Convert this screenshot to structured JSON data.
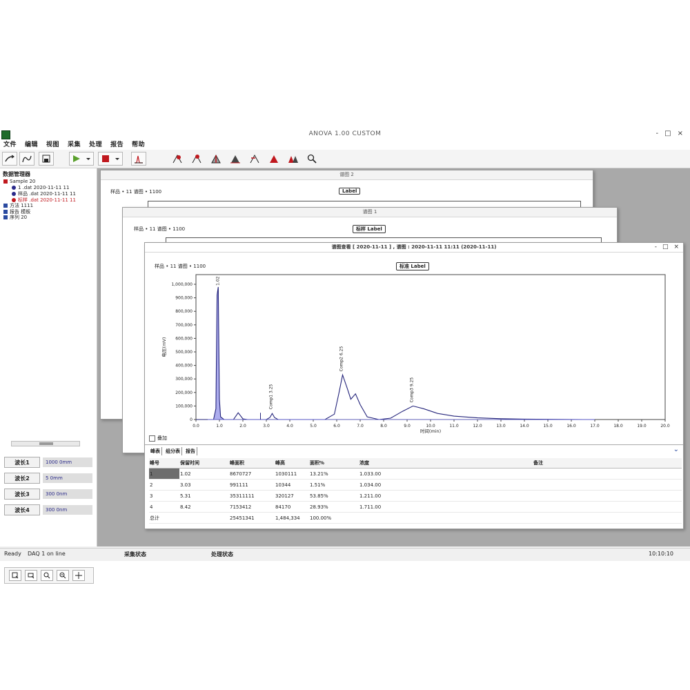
{
  "app": {
    "title": "ANOVA 1.00 CUSTOM",
    "window_controls": [
      "-",
      "□",
      "×"
    ]
  },
  "menu": [
    "文件",
    "编辑",
    "视图",
    "采集",
    "处理",
    "报告",
    "帮助"
  ],
  "toolbar": {
    "buttons": [
      "open-icon",
      "curve-icon",
      "save-icon",
      "run-icon",
      "stop-icon",
      "integrate-icon",
      "peak-icon-1",
      "peak-icon-2",
      "peak-icon-3",
      "peak-icon-4",
      "peak-icon-5",
      "peak-icon-6",
      "peak-icon-7",
      "search-icon"
    ],
    "colors": {
      "run": "#5aa02c",
      "stop": "#c0181e",
      "peak": "#c0181e"
    }
  },
  "tree": {
    "header": "数据管理器",
    "items": [
      {
        "label": "Sample 20",
        "color": "#c0181e",
        "kind": "sq",
        "indent": 0
      },
      {
        "label": "1 .dat 2020-11-11 11",
        "color": "#2a2a8a",
        "kind": "dot",
        "indent": 1
      },
      {
        "label": "样品 .dat 2020-11-11 11",
        "color": "#2a2a8a",
        "kind": "dot",
        "indent": 1
      },
      {
        "label": "标样 .dat 2020-11-11 11",
        "color": "#c0181e",
        "kind": "dot",
        "indent": 1,
        "text_color": "#c0181e"
      },
      {
        "label": "方法 1111",
        "color": "#2a4aa0",
        "kind": "sq",
        "indent": 0
      },
      {
        "label": "报告 模板",
        "color": "#2a4aa0",
        "kind": "sq",
        "indent": 0
      },
      {
        "label": "序列 20",
        "color": "#2a4aa0",
        "kind": "sq",
        "indent": 0
      }
    ]
  },
  "params": [
    {
      "label": "波长1",
      "value": "1000 0mm"
    },
    {
      "label": "波长2",
      "value": "5 0mm"
    },
    {
      "label": "波长3",
      "value": "300 0nm"
    },
    {
      "label": "波长4",
      "value": "300 0nm"
    }
  ],
  "zoom_tools": [
    "zoom-box-icon",
    "zoom-x-icon",
    "zoom-in-icon",
    "zoom-out-icon",
    "pan-icon"
  ],
  "back_windows": [
    {
      "title": "谱图 2",
      "header": "样品 • 11 谱图 • 1100",
      "tag": "Label"
    },
    {
      "title": "谱图 1",
      "header": "样品 • 11 谱图 • 1100",
      "tag": "标样 Label"
    }
  ],
  "front_window": {
    "title": "谱图查看 [ 2020-11-11 ] , 谱图 : 2020-11-11 11:11 (2020-11-11)",
    "header": "样品 • 11 谱图 • 1100",
    "tag": "标准 Label",
    "check_label": "叠加",
    "tabs": [
      "峰表",
      "组分表",
      "报告"
    ],
    "table": {
      "columns": [
        "峰号",
        "保留时间",
        "峰面积",
        "峰高",
        "面积%",
        "浓度",
        "备注"
      ],
      "rows": [
        [
          "1",
          "1.02",
          "8670727",
          "1030111",
          "13.21%",
          "1.033.00",
          ""
        ],
        [
          "2",
          "3.03",
          "991111",
          "10344",
          "1.51%",
          "1.034.00",
          ""
        ],
        [
          "3",
          "5.31",
          "35311111",
          "320127",
          "53.85%",
          "1.211.00",
          ""
        ],
        [
          "4",
          "8.42",
          "7153412",
          "84170",
          "28.93%",
          "1.711.00",
          ""
        ]
      ],
      "total": [
        "总计",
        "",
        "25451341",
        "1,484,334",
        "100.00%",
        "",
        ""
      ]
    }
  },
  "chart_data": {
    "type": "line",
    "title": "",
    "xlabel": "时间(min)",
    "ylabel": "电压(mV)",
    "xlim": [
      0,
      20
    ],
    "ylim": [
      0,
      1000000
    ],
    "x_ticks": [
      "0.0",
      "1.0",
      "2.0",
      "3.0",
      "4.0",
      "5.0",
      "6.0",
      "7.0",
      "8.0",
      "9.0",
      "10.0",
      "11.0",
      "12.0",
      "13.0",
      "14.0",
      "15.0",
      "16.0",
      "17.0",
      "18.0",
      "19.0",
      "20.0"
    ],
    "y_ticks": [
      "0",
      "100,000",
      "200,000",
      "300,000",
      "400,000",
      "500,000",
      "600,000",
      "700,000",
      "800,000",
      "900,000",
      "1,000,000"
    ],
    "peak_labels": [
      {
        "x": 0.98,
        "y": 970000,
        "text": "1.02"
      },
      {
        "x": 3.25,
        "y": 55000,
        "text": "Comp1 3.25"
      },
      {
        "x": 6.25,
        "y": 335000,
        "text": "Comp2 6.25"
      },
      {
        "x": 9.25,
        "y": 105000,
        "text": "Comp3 9.25"
      }
    ],
    "series": [
      {
        "values": [
          [
            0,
            0
          ],
          [
            0.5,
            0
          ],
          [
            0.75,
            0
          ],
          [
            0.85,
            80000
          ],
          [
            0.9,
            920000
          ],
          [
            0.95,
            980000
          ],
          [
            1.0,
            150000
          ],
          [
            1.05,
            20000
          ],
          [
            1.2,
            0
          ],
          [
            1.6,
            0
          ],
          [
            1.8,
            50000
          ],
          [
            2.0,
            5000
          ],
          [
            2.2,
            0
          ],
          [
            3.0,
            0
          ],
          [
            3.15,
            15000
          ],
          [
            3.25,
            45000
          ],
          [
            3.35,
            15000
          ],
          [
            3.5,
            0
          ],
          [
            5.5,
            0
          ],
          [
            5.9,
            40000
          ],
          [
            6.1,
            200000
          ],
          [
            6.25,
            330000
          ],
          [
            6.45,
            230000
          ],
          [
            6.6,
            150000
          ],
          [
            6.8,
            190000
          ],
          [
            7.0,
            110000
          ],
          [
            7.3,
            20000
          ],
          [
            7.8,
            0
          ],
          [
            8.3,
            10000
          ],
          [
            8.8,
            60000
          ],
          [
            9.25,
            100000
          ],
          [
            9.7,
            80000
          ],
          [
            10.3,
            45000
          ],
          [
            11.0,
            25000
          ],
          [
            12.0,
            12000
          ],
          [
            13.0,
            6000
          ],
          [
            14.0,
            3000
          ],
          [
            15.0,
            1500
          ],
          [
            16.5,
            0
          ],
          [
            17.0,
            0
          ]
        ]
      }
    ],
    "colors": {
      "line": "#23237a",
      "fill": "#6a6ae0"
    },
    "grid": false
  },
  "status": [
    "Ready",
    "DAQ 1 on line",
    "采集状态",
    "处理状态",
    "10:10:10"
  ]
}
